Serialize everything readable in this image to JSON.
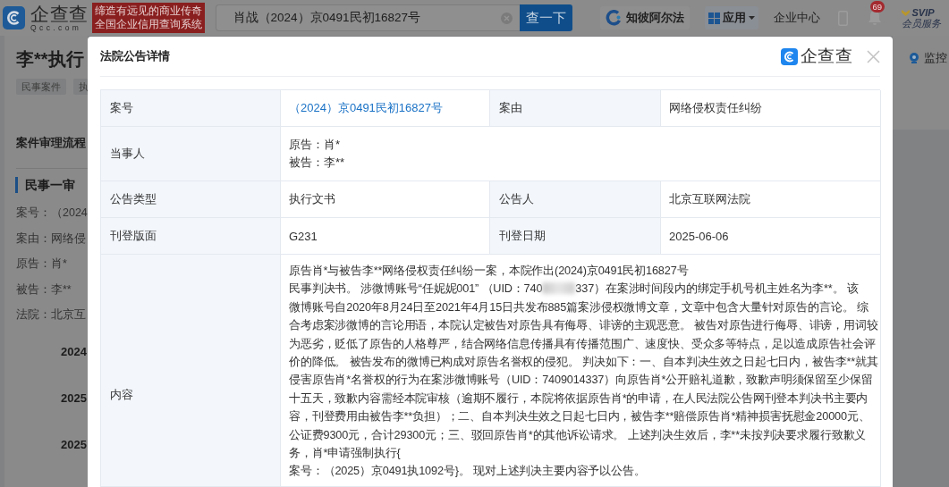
{
  "header": {
    "logo": {
      "name": "企查查",
      "domain": "Qcc.com"
    },
    "slogan": [
      "缔造有远见的商业传奇",
      "全国企业信用查询系统"
    ],
    "search": {
      "value": "肖战（2024）京0491民初16827号",
      "button": "查一下"
    },
    "nav": [
      {
        "kind": "tool",
        "label": "知彼阿尔法"
      },
      {
        "kind": "menu",
        "label": "应用"
      },
      {
        "kind": "link",
        "label": "企业中心"
      },
      {
        "kind": "phone"
      },
      {
        "kind": "bell",
        "badge": "69"
      },
      {
        "kind": "vip",
        "label": "SVIP",
        "sublabel": "会员服务"
      }
    ]
  },
  "page": {
    "title": "李**执行",
    "tags": [
      "民事案件",
      "执"
    ],
    "monitor": "监控",
    "process": {
      "title": "案件审理流程",
      "stage": "民事一审",
      "fields": [
        {
          "label": "案号：",
          "value": "（2024"
        },
        {
          "label": "案由：",
          "value": "网络侵"
        },
        {
          "label": "原告：",
          "value": "肖*"
        },
        {
          "label": "被告：",
          "value": "李**"
        },
        {
          "label": "法院：",
          "value": "北京互"
        }
      ],
      "timeline": [
        "2024",
        "2025",
        "2025"
      ]
    }
  },
  "dialog": {
    "title": "法院公告详情",
    "brand": "企查查",
    "rows": [
      {
        "cells": [
          {
            "label": "案号",
            "kind": "link",
            "value": "（2024）京0491民初16827号"
          },
          {
            "label": "案由",
            "kind": "text",
            "value": "网络侵权责任纠纷"
          }
        ]
      },
      {
        "cells": [
          {
            "label": "当事人",
            "kind": "lines",
            "lines": [
              "原告：肖*",
              "被告：李**"
            ]
          }
        ]
      },
      {
        "cells": [
          {
            "label": "公告类型",
            "kind": "text",
            "value": "执行文书"
          },
          {
            "label": "公告人",
            "kind": "text",
            "value": "北京互联网法院"
          }
        ]
      },
      {
        "cells": [
          {
            "label": "刊登版面",
            "kind": "text",
            "value": "G231"
          },
          {
            "label": "刊登日期",
            "kind": "text",
            "value": "2025-06-06"
          }
        ]
      },
      {
        "cells": [
          {
            "label": "内容",
            "kind": "content",
            "parts": [
              {
                "kind": "text",
                "text": "原告肖*与被告李**网络侵权责任纠纷一案，本院作出(2024)京0491民初16827号"
              },
              {
                "kind": "break"
              },
              {
                "kind": "text",
                "text": "民事判决书。 涉微博账号“任妮妮001” （UID：740"
              },
              {
                "kind": "redacted"
              },
              {
                "kind": "text",
                "text": "337）在案涉时间段内的绑定手机号机主姓名为李**。 该"
              },
              {
                "kind": "break"
              },
              {
                "kind": "text",
                "text": "微博账号自2020年8月24日至2021年4月15日共发布885篇案涉侵权微博文章，文章中包含大量针对原告的言论。 综"
              },
              {
                "kind": "break"
              },
              {
                "kind": "text",
                "text": "合考虑案涉微博的言论用语，本院认定被告对原告具有侮辱、诽谤的主观恶意。 被告对原告进行侮辱、诽谤，用词较"
              },
              {
                "kind": "break"
              },
              {
                "kind": "text",
                "text": "为恶劣，贬低了原告的人格尊严，结合网络信息传播具有传播范围广、速度快、受众多等特点，足以造成原告社会评"
              },
              {
                "kind": "break"
              },
              {
                "kind": "text",
                "text": "价的降低。 被告发布的微博已构成对原告名誉权的侵犯。 判决如下：一、自本判决生效之日起七日内，被告李**就其"
              },
              {
                "kind": "break"
              },
              {
                "kind": "text",
                "text": "侵害原告肖*名誉权的行为在案涉微博账号（UID：7409014337）向原告肖*公开赔礼道歉，致歉声明须保留至少保留"
              },
              {
                "kind": "break"
              },
              {
                "kind": "text",
                "text": "十五天，致歉内容需经本院审核（逾期不履行，本院将依据原告肖*的申请，在人民法院公告网刊登本判决书主要内"
              },
              {
                "kind": "break"
              },
              {
                "kind": "text",
                "text": "容，刊登费用由被告李**负担）；二、自本判决生效之日起七日内，被告李**赔偿原告肖*精神损害抚慰金20000元、"
              },
              {
                "kind": "break"
              },
              {
                "kind": "text",
                "text": "公证费9300元，合计29300元；三、驳回原告肖*的其他诉讼请求。 上述判决生效后，李**未按判决要求履行致歉义"
              },
              {
                "kind": "break"
              },
              {
                "kind": "text",
                "text": "务，肖*申请强制执行{"
              },
              {
                "kind": "break"
              },
              {
                "kind": "text",
                "text": "案号：（2025）京0491执1092号}。 现对上述判决主要内容予以公告。"
              }
            ]
          }
        ]
      }
    ]
  }
}
